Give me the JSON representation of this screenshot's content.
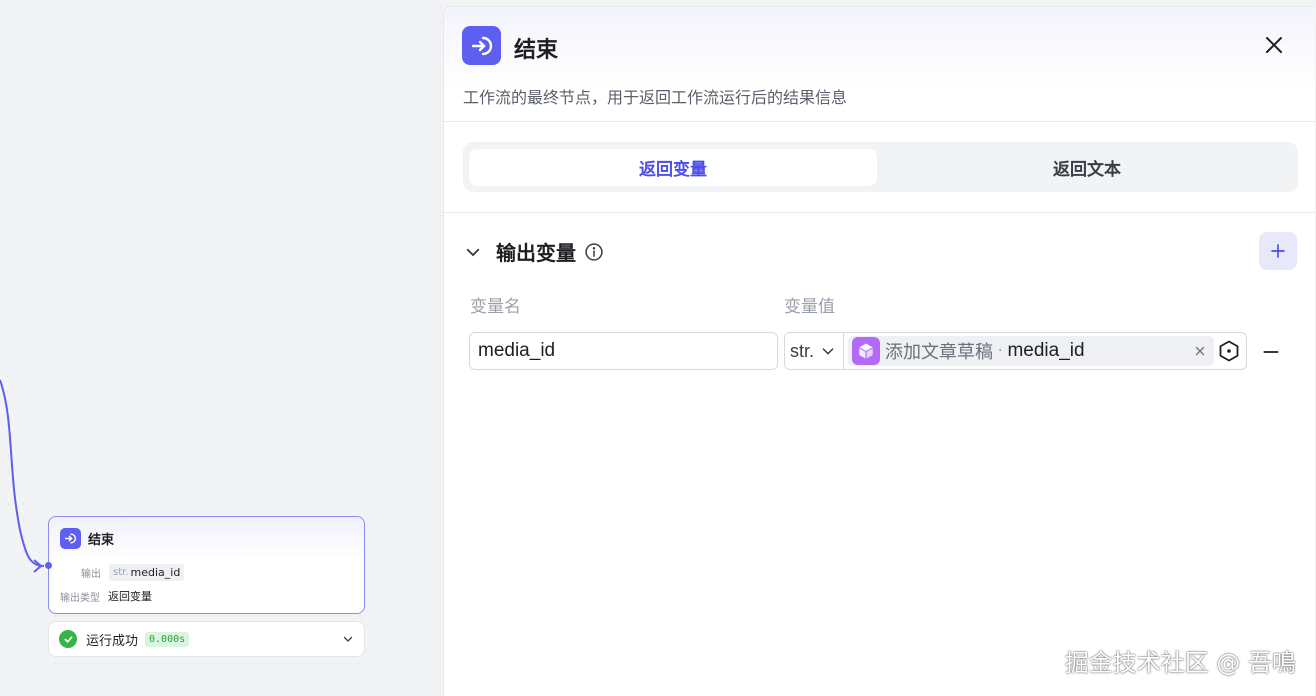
{
  "canvas": {
    "node": {
      "title": "结束",
      "output_label": "输出",
      "output_type": "str.",
      "output_var": "media_id",
      "output_kind_label": "输出类型",
      "output_kind_value": "返回变量"
    },
    "status": {
      "text": "运行成功",
      "time": "0.000s"
    }
  },
  "panel": {
    "title": "结束",
    "description": "工作流的最终节点，用于返回工作流运行后的结果信息",
    "tabs": [
      {
        "label": "返回变量",
        "active": true
      },
      {
        "label": "返回文本",
        "active": false
      }
    ],
    "section": {
      "title": "输出变量",
      "col_name": "变量名",
      "col_value": "变量值"
    },
    "row": {
      "name": "media_id",
      "type": "str.",
      "ref_node": "添加文章草稿",
      "ref_sep": "·",
      "ref_var": "media_id"
    }
  },
  "watermark": "掘金技术社区 @ 吾鳴",
  "colors": {
    "accent": "#5e5ef0",
    "tab_active_text": "#4d4de8",
    "success": "#37b34a",
    "plugin": "#b26af7"
  }
}
